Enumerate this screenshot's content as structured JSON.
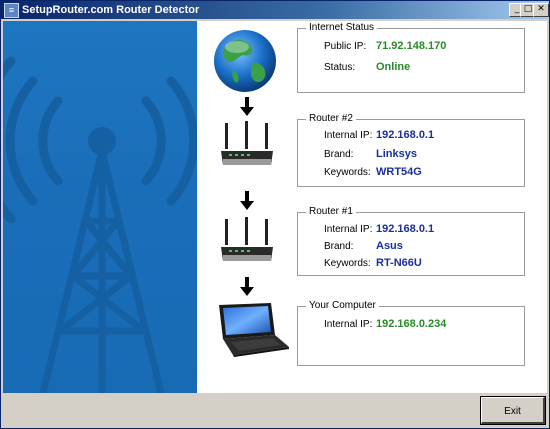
{
  "window": {
    "title": "SetupRouter.com Router Detector",
    "controls": {
      "minimize": "_",
      "maximize": "□",
      "close": "✕"
    }
  },
  "panels": {
    "internet": {
      "legend": "Internet Status",
      "rows": [
        {
          "label": "Public IP:",
          "value": "71.92.148.170"
        },
        {
          "label": "Status:",
          "value": "Online"
        }
      ]
    },
    "router2": {
      "legend": "Router #2",
      "rows": [
        {
          "label": "Internal IP:",
          "value": "192.168.0.1"
        },
        {
          "label": "Brand:",
          "value": "Linksys"
        },
        {
          "label": "Keywords:",
          "value": "WRT54G"
        }
      ]
    },
    "router1": {
      "legend": "Router #1",
      "rows": [
        {
          "label": "Internal IP:",
          "value": "192.168.0.1"
        },
        {
          "label": "Brand:",
          "value": "Asus"
        },
        {
          "label": "Keywords:",
          "value": "RT-N66U"
        }
      ]
    },
    "computer": {
      "legend": "Your Computer",
      "rows": [
        {
          "label": "Internal IP:",
          "value": "192.168.0.234"
        }
      ]
    }
  },
  "icons": [
    "globe-icon",
    "router-icon",
    "laptop-icon",
    "arrow-down-icon",
    "signal-tower-icon"
  ],
  "colors": {
    "accent": "#1a6fba",
    "value_green": "#2a8a2a",
    "value_blue": "#1a2f9a"
  },
  "footer": {
    "exit_label": "Exit"
  }
}
